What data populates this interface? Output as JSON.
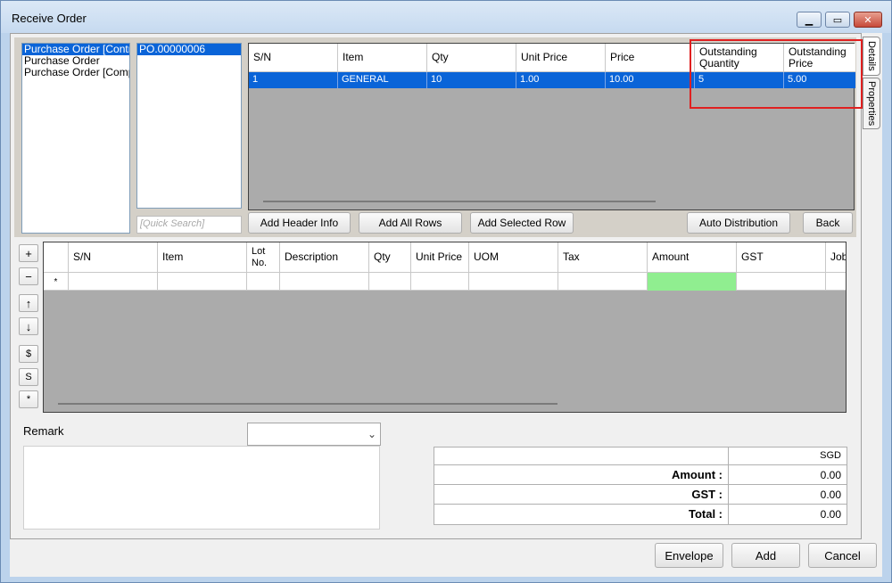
{
  "window": {
    "title": "Receive Order",
    "min_icon": "minimize-icon",
    "max_icon": "maximize-icon",
    "close_icon": "close-icon"
  },
  "order_types": [
    {
      "label": "Purchase Order [Contra",
      "selected": true
    },
    {
      "label": "Purchase Order",
      "selected": false
    },
    {
      "label": "Purchase Order [Comple",
      "selected": false
    }
  ],
  "documents": [
    {
      "label": "PO.00000006",
      "selected": true
    }
  ],
  "quick_search": {
    "placeholder": "[Quick Search]"
  },
  "po_grid": {
    "columns": [
      "S/N",
      "Item",
      "Qty",
      "Unit Price",
      "Price",
      "Outstanding Quantity",
      "Outstanding Price"
    ],
    "rows": [
      {
        "sn": "1",
        "item": "GENERAL",
        "qty": "10",
        "unit_price": "1.00",
        "price": "10.00",
        "outstanding_qty": "5",
        "outstanding_price": "5.00"
      }
    ]
  },
  "po_buttons": {
    "add_header_info": "Add Header Info",
    "add_all_rows": "Add All Rows",
    "add_selected_row": "Add Selected Row",
    "auto_distribution": "Auto Distribution",
    "back": "Back"
  },
  "side_tabs": {
    "details": "Details",
    "properties": "Properties"
  },
  "tools": {
    "add": "+",
    "remove": "−",
    "up": "↑",
    "down": "↓",
    "dollar": "$",
    "s": "S",
    "star": "*"
  },
  "detail_grid": {
    "columns": [
      "S/N",
      "Item",
      "Lot No.",
      "Description",
      "Qty",
      "Unit Price",
      "UOM",
      "Tax",
      "Amount",
      "GST",
      "Job"
    ],
    "new_row_marker": "*",
    "amount_color": "#90ee90"
  },
  "remark": {
    "label": "Remark"
  },
  "totals": {
    "currency": "SGD",
    "amount_label": "Amount :",
    "amount": "0.00",
    "gst_label": "GST :",
    "gst": "0.00",
    "total_label": "Total :",
    "total": "0.00"
  },
  "footer": {
    "envelope": "Envelope",
    "add": "Add",
    "cancel": "Cancel"
  }
}
